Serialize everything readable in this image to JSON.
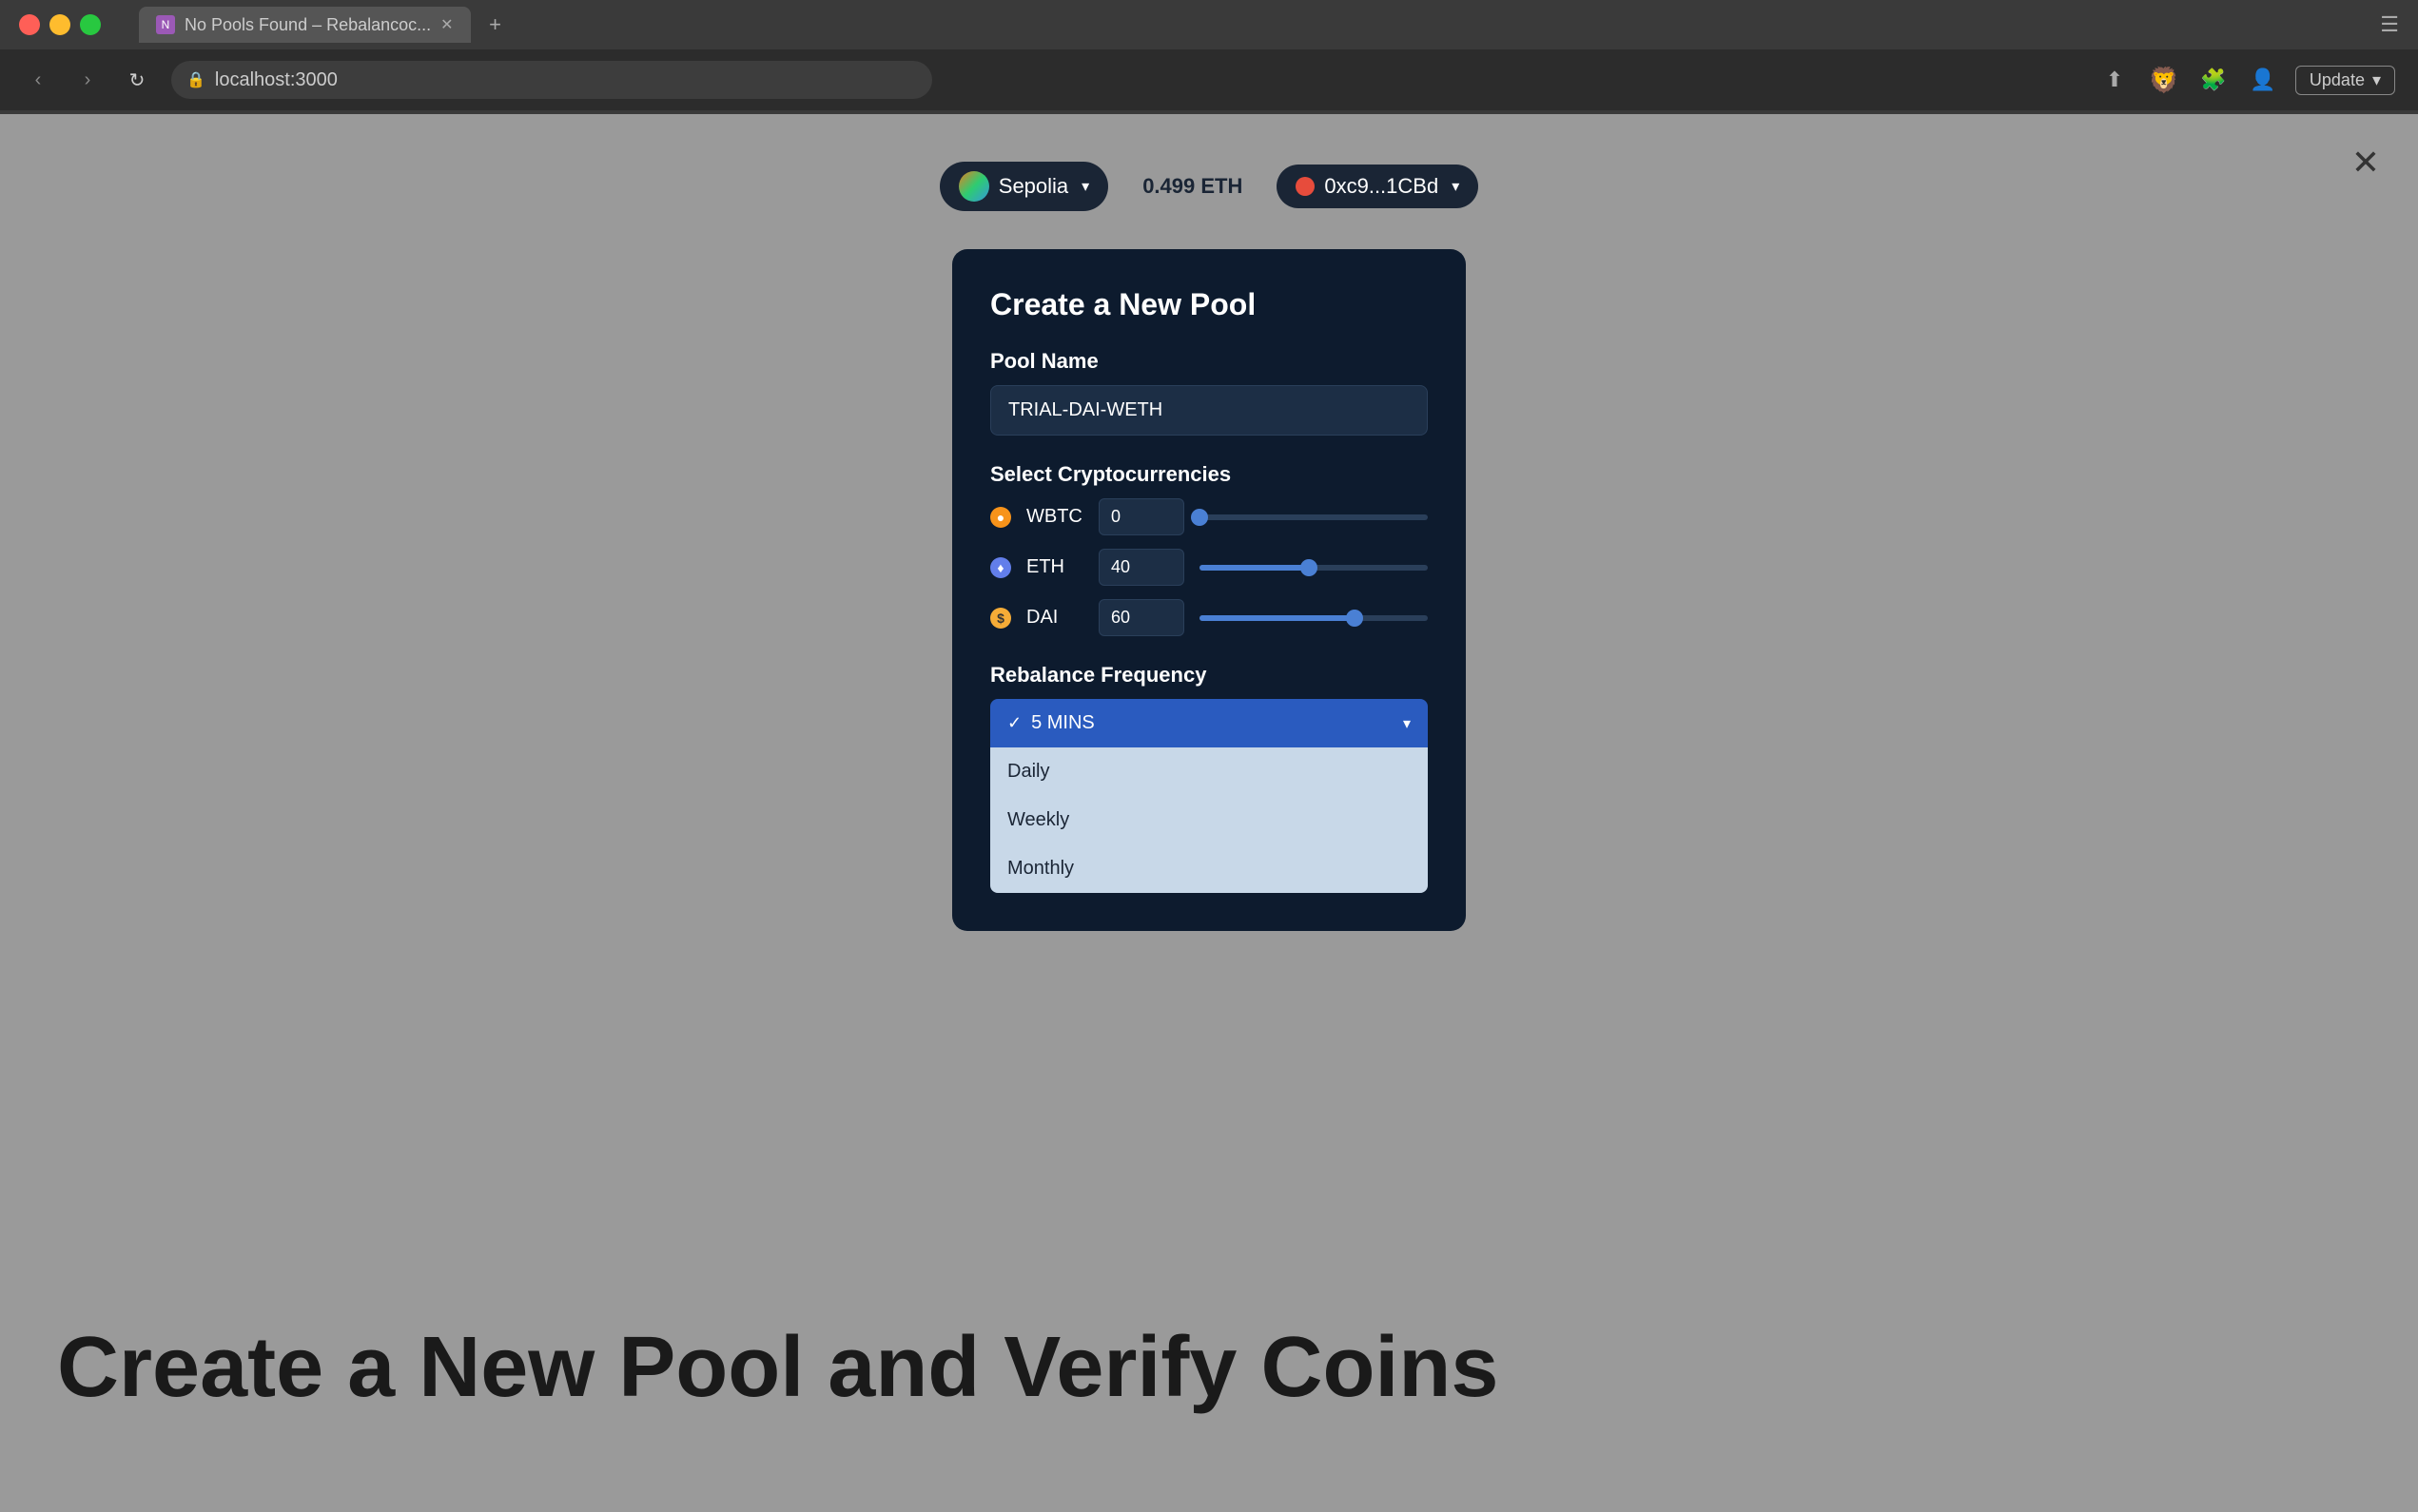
{
  "browser": {
    "tab_title": "No Pools Found – Rebalancoc...",
    "address": "localhost:3000",
    "update_label": "Update"
  },
  "header": {
    "network": {
      "name": "Sepolia",
      "chevron": "▾"
    },
    "balance": "0.499 ETH",
    "wallet": {
      "address": "0xc9...1CBd",
      "chevron": "▾"
    }
  },
  "modal": {
    "title": "Create a New Pool",
    "pool_name_label": "Pool Name",
    "pool_name_value": "TRIAL-DAI-WETH",
    "pool_name_placeholder": "TRIAL-DAI-WETH",
    "crypto_section_label": "Select Cryptocurrencies",
    "cryptos": [
      {
        "id": "wbtc",
        "symbol": "WBTC",
        "icon_char": "₿",
        "value": "0",
        "fill_pct": 0,
        "thumb_pct": 0
      },
      {
        "id": "eth",
        "symbol": "ETH",
        "icon_char": "♦",
        "value": "40",
        "fill_pct": 48,
        "thumb_pct": 48
      },
      {
        "id": "dai",
        "symbol": "DAI",
        "icon_char": "$",
        "value": "60",
        "fill_pct": 68,
        "thumb_pct": 68
      }
    ],
    "rebalance_label": "Rebalance Frequency",
    "selected_option": "5 MINS",
    "options": [
      {
        "id": "5mins",
        "label": "5 MINS",
        "selected": true
      },
      {
        "id": "daily",
        "label": "Daily",
        "selected": false
      },
      {
        "id": "weekly",
        "label": "Weekly",
        "selected": false
      },
      {
        "id": "monthly",
        "label": "Monthly",
        "selected": false
      }
    ]
  },
  "bottom_text": "Create a New Pool and Verify Coins",
  "close_icon": "✕"
}
